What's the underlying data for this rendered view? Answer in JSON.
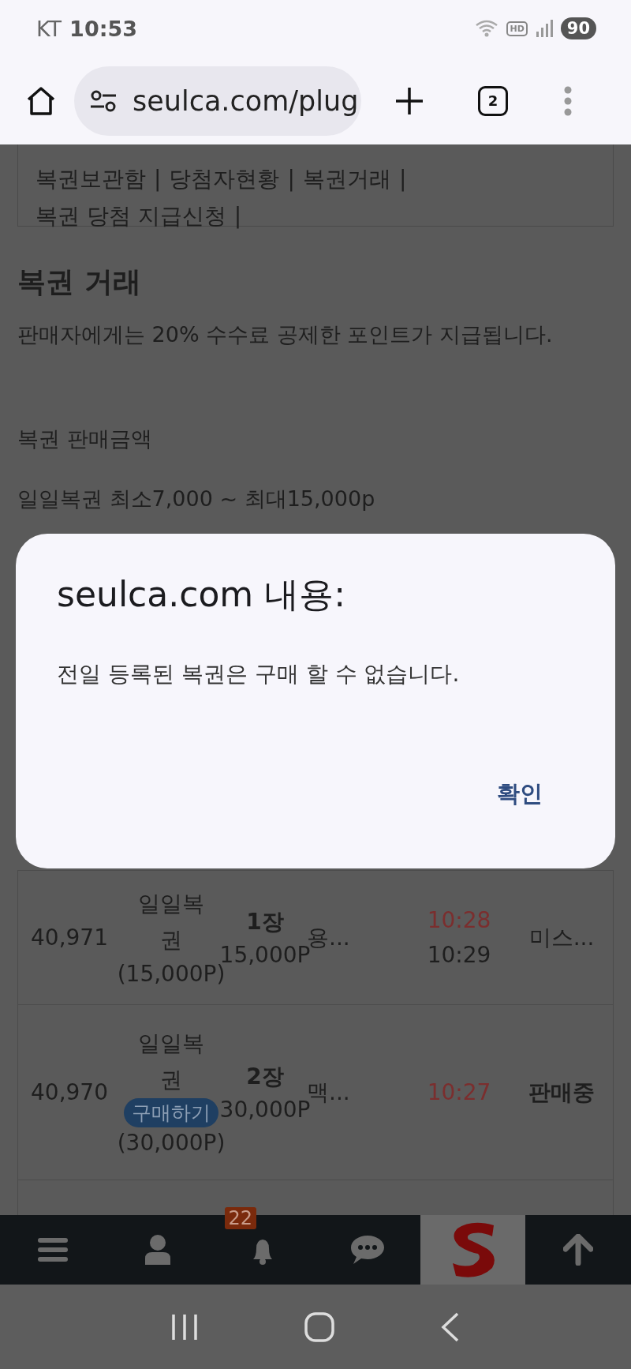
{
  "status_bar": {
    "carrier": "KT",
    "time": "10:53",
    "hd": "HD",
    "battery": "90"
  },
  "browser": {
    "url": "seulca.com/plug",
    "tab_count": "2"
  },
  "page": {
    "menu_links": [
      {
        "label": "복권보관함",
        "separator": "|"
      },
      {
        "label": "당첨자현황",
        "separator": "|"
      },
      {
        "label": "복권거래",
        "separator": "|"
      },
      {
        "label": "복권 당첨 지급신청",
        "separator": "|"
      }
    ],
    "heading": "복권 거래",
    "paragraphs": [
      "판매자에게는 20% 수수료 공제한 포인트가 지급됩니다.",
      "복권 판매금액",
      "일일복권 최소7,000 ~ 최대15,000p"
    ],
    "rows": [
      {
        "number": "40,971",
        "type": "일일복권",
        "price": "(15,000P)",
        "count": "1장",
        "amount": "15,000P",
        "seller": "용...",
        "times": [
          {
            "text": "10:28",
            "kind": "posted"
          },
          {
            "text": "10:29",
            "kind": "sold"
          }
        ],
        "status": {
          "text": "미스...",
          "kind": "buyer"
        }
      },
      {
        "number": "40,970",
        "type": "일일복권",
        "buy_button": "구매하기",
        "price": "(30,000P)",
        "count": "2장",
        "amount": "30,000P",
        "seller": "맥...",
        "times": [
          {
            "text": "10:27",
            "kind": "posted"
          }
        ],
        "status": {
          "text": "판매중",
          "kind": "state"
        }
      }
    ]
  },
  "dialog": {
    "title": "seulca.com 내용:",
    "message": "전일 등록된 복권은 구매 할 수 없습니다.",
    "button": "확인"
  },
  "bottom_nav": {
    "badge": "22"
  }
}
